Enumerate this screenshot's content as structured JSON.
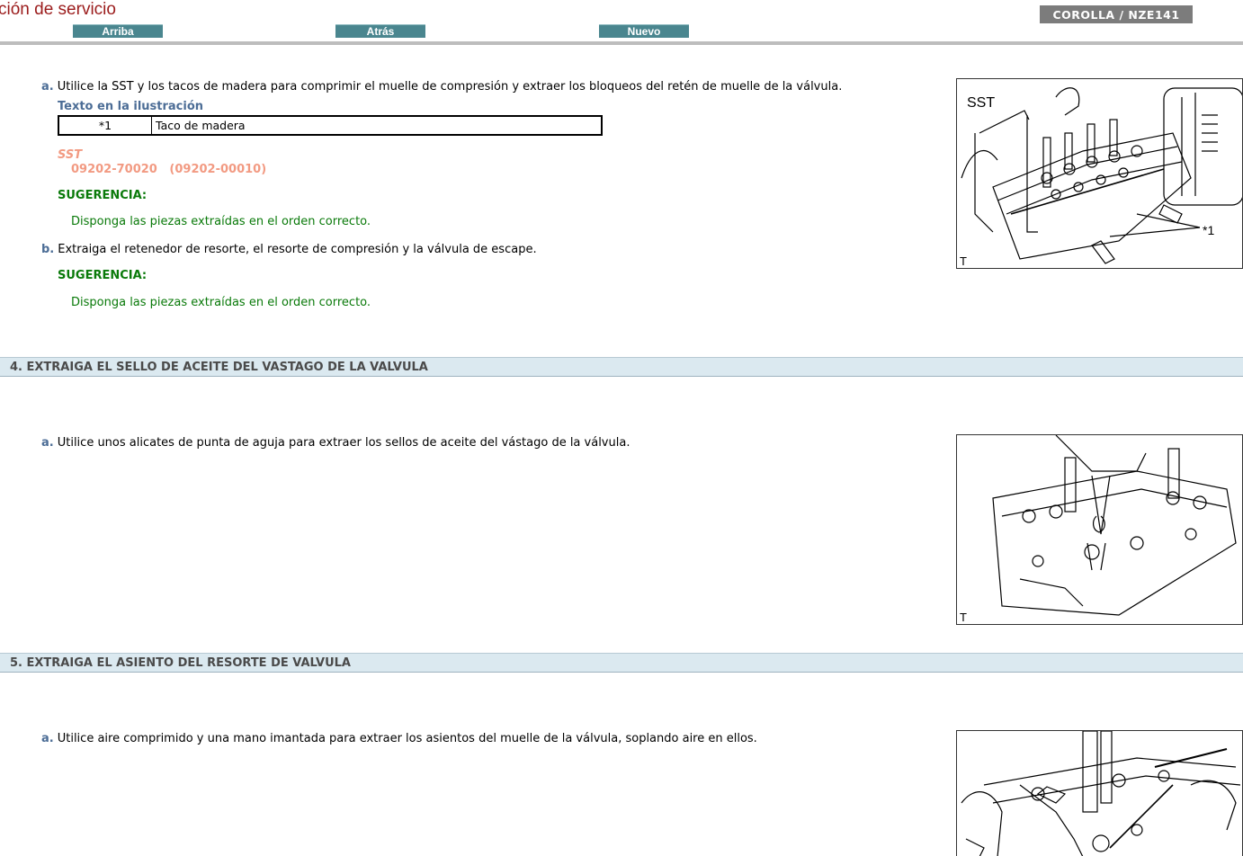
{
  "header": {
    "title": "ción de servicio",
    "nav": {
      "up": "Arriba",
      "back": "Atrás",
      "new": "Nuevo"
    },
    "model": "COROLLA / NZE141"
  },
  "step3": {
    "a_letter": "a.",
    "a_text": "Utilice la SST y los tacos de madera para comprimir el muelle de compresión y extraer los bloqueos del retén de muelle de la válvula.",
    "illus_title": "Texto en la ilustración",
    "callouts": [
      {
        "id": "*1",
        "label": "Taco de madera"
      }
    ],
    "sst_label": "SST",
    "sst_number": "09202-70020   (09202-00010)",
    "hint_label": "SUGERENCIA:",
    "hint_text": "Disponga las piezas extraídas en el orden correcto.",
    "b_letter": "b.",
    "b_text": "Extraiga el retenedor de resorte, el resorte de compresión y la válvula de escape.",
    "b_hint_label": "SUGERENCIA:",
    "b_hint_text": "Disponga las piezas extraídas en el orden correcto.",
    "figure": {
      "sst": "SST",
      "callout": "*1",
      "corner": "T"
    }
  },
  "section4": {
    "heading": "4. EXTRAIGA EL SELLO DE ACEITE DEL VASTAGO DE LA VALVULA",
    "a_letter": "a.",
    "a_text": "Utilice unos alicates de punta de aguja para extraer los sellos de aceite del vástago de la válvula.",
    "figure": {
      "corner": "T"
    }
  },
  "section5": {
    "heading": "5. EXTRAIGA EL ASIENTO DEL RESORTE DE VALVULA",
    "a_letter": "a.",
    "a_text": "Utilice aire comprimido y una mano imantada para extraer los asientos del muelle de la válvula, soplando aire en ellos."
  },
  "colors": {
    "title": "#9b1c1c",
    "nav": "#4a868f",
    "hint": "#0a7a0a",
    "sst": "#f29a82",
    "step_letter": "#4c6d96",
    "section_bg": "#dbe9f0"
  }
}
